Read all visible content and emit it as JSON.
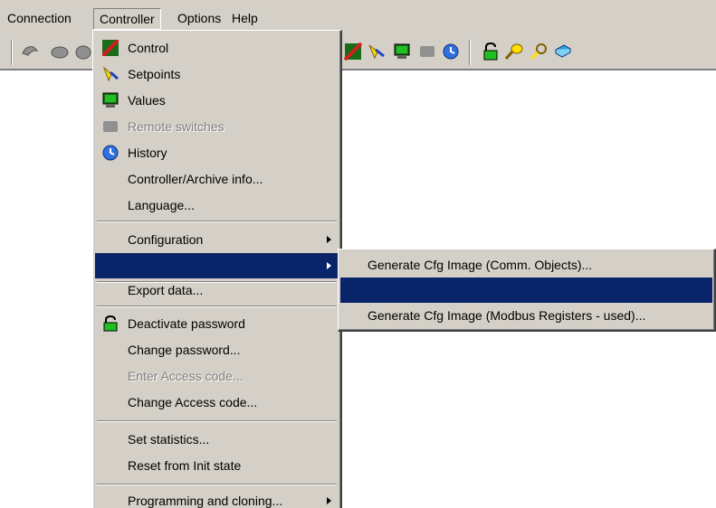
{
  "menubar": {
    "items": [
      "Connection",
      "Controller",
      "Options",
      "Help"
    ]
  },
  "toolbar": {
    "icons": [
      "connect-icon",
      "disconnect-icon",
      "control-icon",
      "setpoints-icon",
      "values-icon",
      "remote-switches-icon",
      "history-icon",
      "lock-icon",
      "key-icon",
      "search-key-icon",
      "book-icon"
    ]
  },
  "controller_menu": {
    "items": {
      "control": "Control",
      "setpoints": "Setpoints",
      "values": "Values",
      "remote_switches": "Remote switches",
      "history": "History",
      "controller_archive_info": "Controller/Archive info...",
      "language": "Language...",
      "configuration": "Configuration",
      "highlighted_blank": "",
      "export_data": "Export data...",
      "deactivate_password": "Deactivate password",
      "change_password": "Change password...",
      "enter_access_code": "Enter Access code...",
      "change_access_code": "Change Access code...",
      "set_statistics": "Set statistics...",
      "reset_from_init": "Reset from Init state",
      "programming_cloning": "Programming and cloning..."
    }
  },
  "submenu": {
    "items": {
      "comm_objects": "Generate Cfg Image (Comm. Objects)...",
      "highlighted_blank": "",
      "modbus_used": "Generate Cfg Image (Modbus Registers - used)..."
    }
  },
  "colors": {
    "face": "#d4d0c8",
    "highlight": "#0a246a",
    "disabled": "#808080"
  }
}
